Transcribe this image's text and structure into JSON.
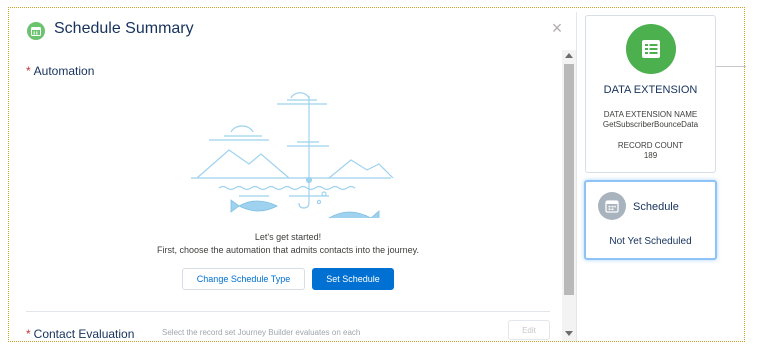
{
  "modal": {
    "title": "Schedule Summary",
    "close_glyph": "×",
    "title_icon": "calendar-icon",
    "automation": {
      "required_mark": "*",
      "label": "Automation",
      "illustration": "fishing-illustration",
      "heading": "Let's get started!",
      "subtext": "First, choose the automation that admits contacts into the journey.",
      "change_button": "Change Schedule Type",
      "set_button": "Set Schedule"
    },
    "contact_evaluation": {
      "required_mark": "*",
      "label": "Contact Evaluation",
      "description": "Select the record set Journey Builder evaluates on each",
      "edit_button": "Edit"
    }
  },
  "data_extension_card": {
    "icon": "table-icon",
    "title": "DATA EXTENSION",
    "name_label": "DATA EXTENSION NAME",
    "name_value": "GetSubscriberBounceData",
    "count_label": "RECORD COUNT",
    "count_value": "189"
  },
  "schedule_card": {
    "icon": "calendar-icon",
    "title": "Schedule",
    "status": "Not Yet Scheduled"
  },
  "colors": {
    "brand_blue": "#0070d2",
    "icon_green": "#4cb04f",
    "required_red": "#c23934",
    "selection_frame": "#c9a227"
  }
}
